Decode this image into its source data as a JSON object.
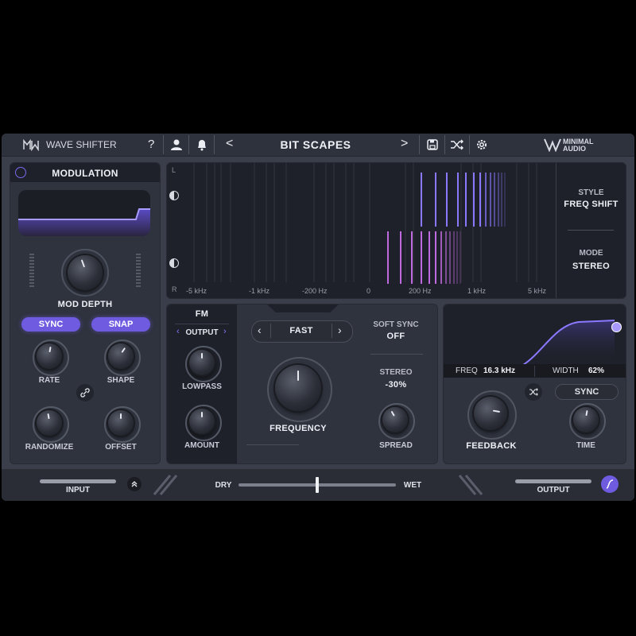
{
  "app": {
    "title": "WAVE SHIFTER",
    "brand": "MINIMAL AUDIO",
    "preset": "BIT SCAPES",
    "accent": "#7b68ee"
  },
  "toolbar": {
    "help": "?",
    "prev": "<",
    "next": ">"
  },
  "modulation": {
    "header": "MODULATION",
    "mod_depth_label": "MOD DEPTH",
    "sync": "SYNC",
    "snap": "SNAP",
    "rate": "RATE",
    "shape": "SHAPE",
    "randomize": "RANDOMIZE",
    "offset": "OFFSET"
  },
  "spectrum": {
    "channel_l": "L",
    "channel_r": "R",
    "ticks": [
      "-5 kHz",
      "-1 kHz",
      "-200 Hz",
      "0",
      "200 Hz",
      "1 kHz",
      "5 kHz"
    ],
    "style_label": "STYLE",
    "style_value": "FREQ SHIFT",
    "mode_label": "MODE",
    "mode_value": "STEREO"
  },
  "fm": {
    "header": "FM",
    "target": "OUTPUT",
    "lowpass": "LOWPASS",
    "amount": "AMOUNT"
  },
  "center": {
    "speed": "FAST",
    "frequency": "FREQUENCY",
    "soft_sync_label": "SOFT SYNC",
    "soft_sync_value": "OFF",
    "stereo_label": "STEREO",
    "stereo_value": "-30%",
    "spread": "SPREAD"
  },
  "delay": {
    "freq_label": "FREQ",
    "freq_value": "16.3 kHz",
    "width_label": "WIDTH",
    "width_value": "62%",
    "sync": "SYNC",
    "feedback": "FEEDBACK",
    "time": "TIME"
  },
  "footer": {
    "input": "INPUT",
    "dry": "DRY",
    "wet": "WET",
    "output": "OUTPUT",
    "dry_wet_mix": 0.5
  }
}
